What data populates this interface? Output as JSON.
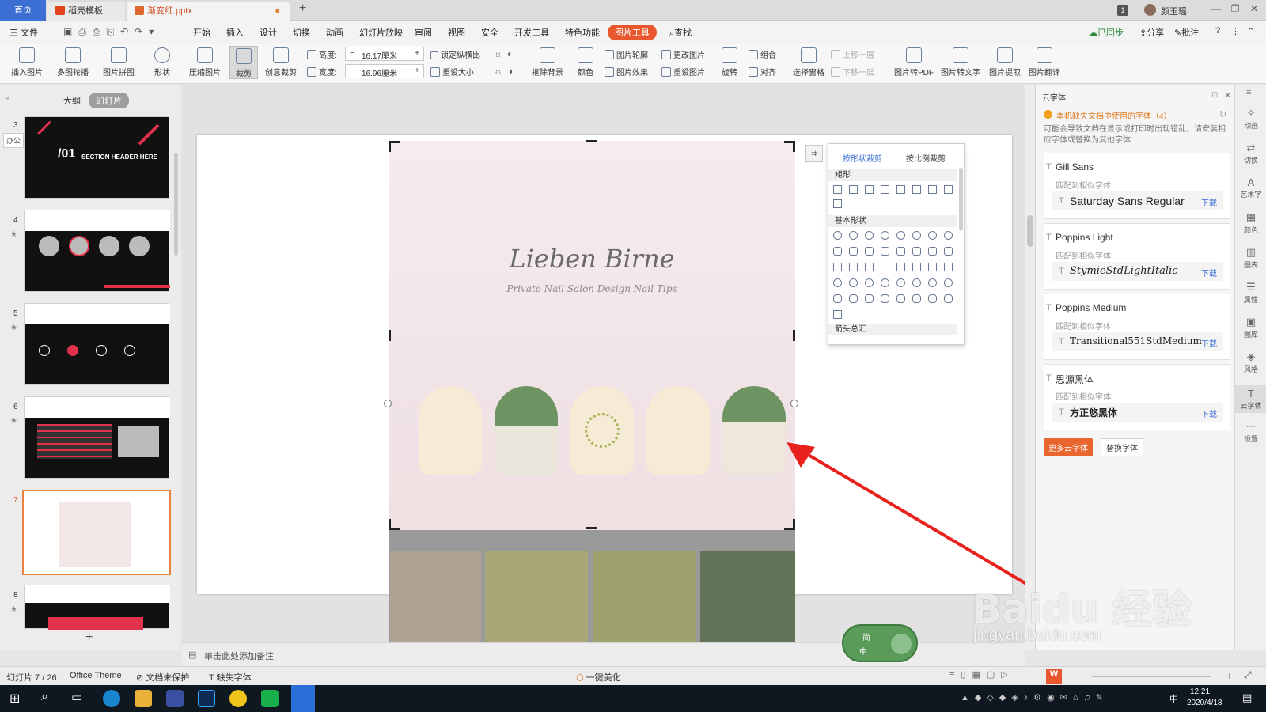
{
  "titlebar": {
    "tabs": [
      {
        "label": "首页"
      },
      {
        "label": "稻壳模板"
      },
      {
        "label": "渐变红.pptx"
      }
    ],
    "page_indicator": "1",
    "user_name": "颜玉瑶"
  },
  "menu": {
    "file": "三 文件",
    "items": [
      "开始",
      "插入",
      "设计",
      "切换",
      "动画",
      "幻灯片放映",
      "审阅",
      "视图",
      "安全",
      "开发工具",
      "特色功能"
    ],
    "active": "图片工具",
    "search": "查找",
    "right": [
      "已同步",
      "分享",
      "批注"
    ]
  },
  "ribbon": {
    "big_buttons": [
      {
        "label": "插入图片"
      },
      {
        "label": "多图轮播"
      },
      {
        "label": "图片拼图"
      },
      {
        "label": "形状"
      },
      {
        "label": "压缩图片"
      },
      {
        "label": "裁剪"
      },
      {
        "label": "创意裁剪"
      }
    ],
    "height_label": "高度:",
    "height_value": "16.17厘米",
    "width_label": "宽度:",
    "width_value": "16.96厘米",
    "lock_ratio": "锁定纵横比",
    "reset_size": "重设大小",
    "buttons2": [
      {
        "label": "抠除背景"
      },
      {
        "label": "颜色"
      }
    ],
    "small_buttons": [
      {
        "label": "图片轮廓"
      },
      {
        "label": "图片效果"
      },
      {
        "label": "更改图片"
      },
      {
        "label": "重设图片"
      },
      {
        "label": "组合"
      },
      {
        "label": "对齐"
      },
      {
        "label": "上移一层"
      },
      {
        "label": "下移一层"
      }
    ],
    "buttons3": [
      {
        "label": "旋转"
      },
      {
        "label": "选择窗格"
      },
      {
        "label": "图片转PDF"
      },
      {
        "label": "图片转文字"
      },
      {
        "label": "图片提取"
      },
      {
        "label": "图片翻译"
      }
    ]
  },
  "leftpanel": {
    "tabs": [
      "大纲",
      "幻灯片"
    ],
    "side_label": "办公",
    "thumb3_title": "SECTION HEADER HERE",
    "thumb3_num": "/01",
    "slides": [
      "3",
      "4",
      "5",
      "6",
      "7",
      "8"
    ],
    "add": "+"
  },
  "slide": {
    "logo_title": "Lieben Birne",
    "logo_sub": "Private Nail Salon Design Nail Tips",
    "swatches": [
      "#ada294",
      "#a9a778",
      "#9ea06e",
      "#627457"
    ]
  },
  "shapepanel": {
    "tabs": [
      "按形状裁剪",
      "按比例裁剪"
    ],
    "sections": [
      "矩形",
      "基本形状",
      "箭头总汇"
    ]
  },
  "fontpane": {
    "title": "云字体",
    "warning": "本机缺失文档中使用的字体（4）",
    "desc": "可能会导致文档在显示或打印时出现错乱，请安装相应字体或替换为其他字体",
    "match_label": "匹配到相似字体:",
    "download": "下载",
    "fonts": [
      {
        "name": "Gill Sans",
        "match": "Saturday Sans Regular"
      },
      {
        "name": "Poppins Light",
        "match": "StymieStdLightItalic"
      },
      {
        "name": "Poppins Medium",
        "match": "Transitional551StdMedium"
      },
      {
        "name": "思源黑体",
        "match": "方正悠黑体"
      }
    ],
    "more_btn": "更多云字体",
    "replace_btn": "替换字体"
  },
  "toolstrip": [
    "动画",
    "切换",
    "艺术字",
    "颜色",
    "图表",
    "属性",
    "图库",
    "风格",
    "云字体",
    "设置"
  ],
  "notes_placeholder": "单击此处添加备注",
  "status": {
    "slide_info": "幻灯片 7 / 26",
    "theme": "Office Theme",
    "protect": "文档未保护",
    "missing_font": "缺失字体",
    "beautify": "一键美化",
    "zoom": "+"
  },
  "taskbar": {
    "time": "12:21",
    "date": "2020/4/18",
    "ime": "中"
  },
  "watermark": "Baidu 经验",
  "watermark_url": "jingyan.baidu.com",
  "ime_widget": {
    "top": "简",
    "bottom": "中"
  }
}
